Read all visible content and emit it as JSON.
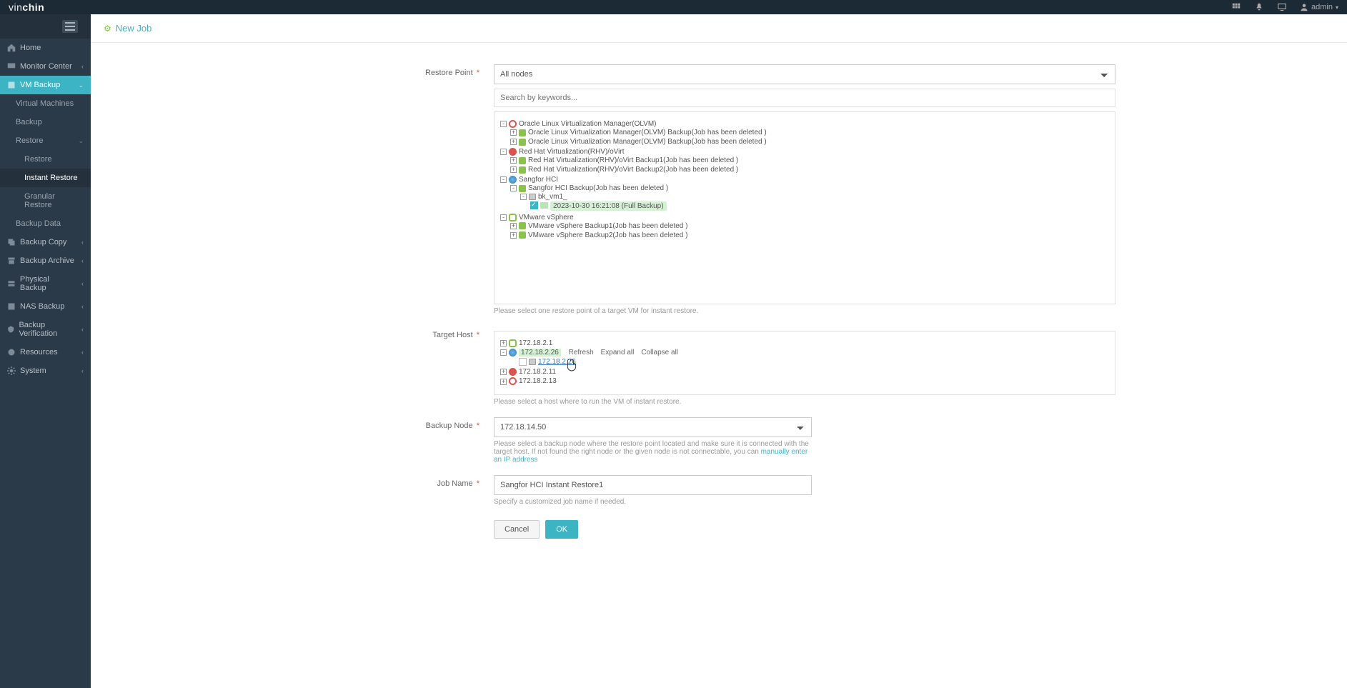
{
  "brand_prefix": "vin",
  "brand_suffix": "chin",
  "user_label": "admin",
  "nav": {
    "home": "Home",
    "monitor": "Monitor Center",
    "vm_backup": "VM Backup",
    "virtual_machines": "Virtual Machines",
    "backup": "Backup",
    "restore": "Restore",
    "restore_sub": "Restore",
    "instant_restore": "Instant Restore",
    "granular_restore": "Granular Restore",
    "backup_data": "Backup Data",
    "backup_copy": "Backup Copy",
    "backup_archive": "Backup Archive",
    "physical_backup": "Physical Backup",
    "nas_backup": "NAS Backup",
    "backup_verification": "Backup Verification",
    "resources": "Resources",
    "system": "System"
  },
  "page_title": "New Job",
  "labels": {
    "restore_point": "Restore Point",
    "target_host": "Target Host",
    "backup_node": "Backup Node",
    "job_name": "Job Name"
  },
  "restore_point_select": "All nodes",
  "search_placeholder": "Search by keywords...",
  "restore_tree": {
    "olvm": "Oracle Linux Virtualization Manager(OLVM)",
    "olvm_b1": "Oracle Linux Virtualization Manager(OLVM) Backup(Job has been deleted )",
    "olvm_b2": "Oracle Linux Virtualization Manager(OLVM) Backup(Job has been deleted )",
    "rhv": "Red Hat Virtualization(RHV)/oVirt",
    "rhv_b1": "Red Hat Virtualization(RHV)/oVirt Backup1(Job has been deleted )",
    "rhv_b2": "Red Hat Virtualization(RHV)/oVirt Backup2(Job has been deleted )",
    "sangfor": "Sangfor HCI",
    "sangfor_b": "Sangfor HCI Backup(Job has been deleted )",
    "sangfor_vm": "bk_vm1_",
    "sangfor_snapshot": "2023-10-30 16:21:08 (Full  Backup)",
    "vmware": "VMware vSphere",
    "vmware_b1": "VMware vSphere Backup1(Job has been deleted )",
    "vmware_b2": "VMware vSphere Backup2(Job has been deleted )"
  },
  "restore_hint": "Please select one restore point of a target VM for instant restore.",
  "host_tree": {
    "h1": "172.18.2.1",
    "h2": "172.18.2.26",
    "h2_sub": "172.18.2.26",
    "h3": "172.18.2.11",
    "h4": "172.18.2.13",
    "ctx_refresh": "Refresh",
    "ctx_expand": "Expand all",
    "ctx_collapse": "Collapse all"
  },
  "host_hint": "Please select a host where to run the VM of instant restore.",
  "backup_node_value": "172.18.14.50",
  "backup_node_hint_pre": "Please select a backup node where the restore point located and make sure it is connected with the target host. If not found the right node or the given node is not connectable, you can ",
  "backup_node_hint_link": "manually enter an IP address",
  "job_name_value": "Sangfor HCI Instant Restore1",
  "job_name_hint": "Specify a customized job name if needed.",
  "btn_cancel": "Cancel",
  "btn_ok": "OK"
}
